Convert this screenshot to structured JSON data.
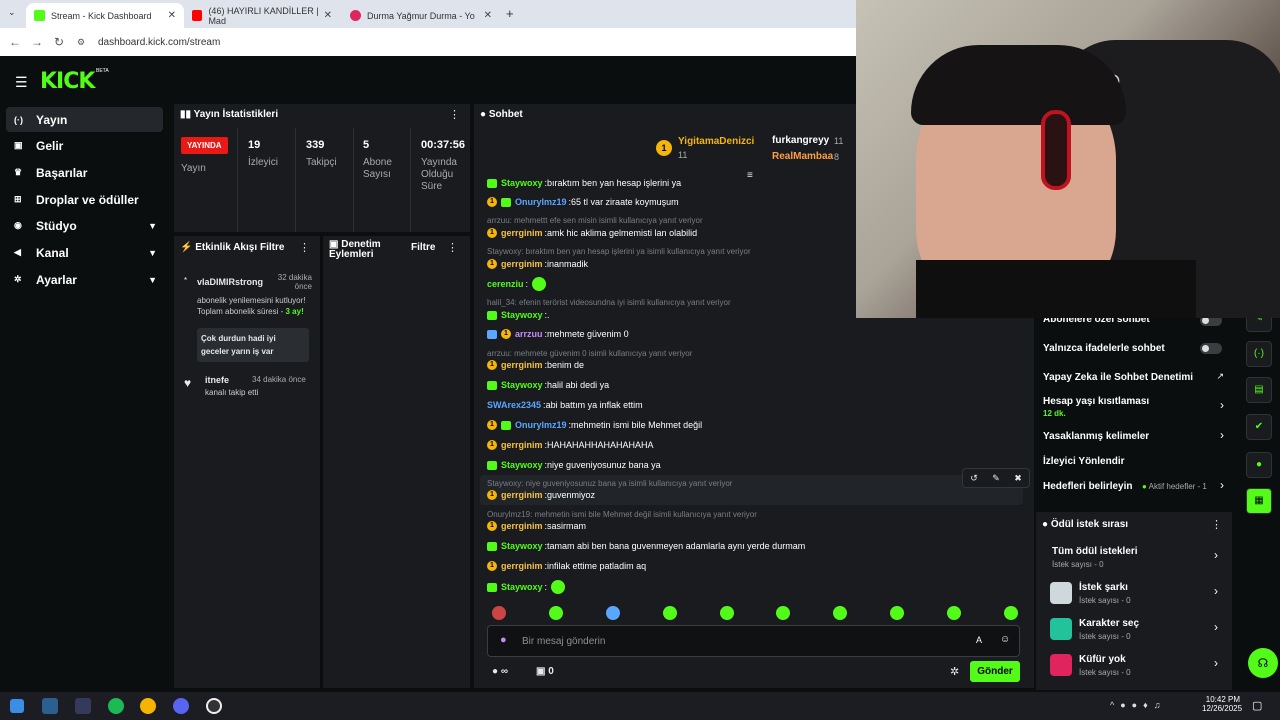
{
  "browser": {
    "tabs": [
      {
        "title": "Stream - Kick Dashboard"
      },
      {
        "title": "(46) HAYIRLI KANDİLLER | Mad"
      },
      {
        "title": "Durma Yağmur Durma - Yo"
      }
    ],
    "url": "dashboard.kick.com/stream"
  },
  "brand": {
    "logo": "KICK",
    "badge": "BETA"
  },
  "sidebar": {
    "items": [
      {
        "label": "Yayın",
        "icon": "broadcast-icon"
      },
      {
        "label": "Gelir",
        "icon": "revenue-icon"
      },
      {
        "label": "Başarılar",
        "icon": "trophy-icon"
      },
      {
        "label": "Droplar ve ödüller",
        "icon": "gift-icon"
      },
      {
        "label": "Stüdyo",
        "icon": "studio-icon"
      },
      {
        "label": "Kanal",
        "icon": "megaphone-icon"
      },
      {
        "label": "Ayarlar",
        "icon": "gear-icon"
      }
    ]
  },
  "stats": {
    "title": "Yayın İstatistikleri",
    "live": "YAYINDA",
    "live_label": "Yayın",
    "viewers": "19",
    "viewers_label": "İzleyici",
    "followers": "339",
    "followers_label": "Takipçi",
    "subs": "5",
    "subs_label": "Abone Sayısı",
    "uptime": "00:37:56",
    "uptime_label": "Yayında Olduğu Süre"
  },
  "activity": {
    "title": "Etkinlik Akışı",
    "filter": "Filtre",
    "e1_user": "vlaDIMIRstrong",
    "e1_time": "32 dakika önce",
    "e1_text": "abonelik yenilemesini kutluyor! Toplam abonelik süresi -",
    "e1_months": "3 ay!",
    "e1_msg": "Çok durdun hadi iyi geceler yarın iş var",
    "e2_user": "itnefe",
    "e2_time": "34 dakika önce",
    "e2_text": "kanalı takip etti"
  },
  "mod": {
    "title": "Denetim Eylemleri",
    "filter": "Filtre"
  },
  "chat": {
    "title": "Sohbet",
    "top1": "YigitamaDenizci",
    "top1_n": "11",
    "top2": "furkangreyy",
    "top2_n": "11",
    "top3": "RealMambaa",
    "top3_n": "8",
    "messages": [
      {
        "u": "Staywoxy",
        "t": "bıraktım ben yan hesap işlerini ya"
      },
      {
        "u": "Onurylmz19",
        "t": "65 tl var ziraate koymuşum"
      },
      {
        "r": "arrzuu: mehmettt efe sen misin isimli kullanıcıya yanıt veriyor"
      },
      {
        "u": "gerrginim",
        "t": "amk hic aklima gelmemisti lan olabilid"
      },
      {
        "r": "Staywoxy: bıraktım ben yan hesap işlerini ya isimli kullanıcıya yanıt veriyor"
      },
      {
        "u": "gerrginim",
        "t": "inanmadik"
      },
      {
        "u": "cerenziu",
        "t": ""
      },
      {
        "r": "halil_34: efenin terörist videosundna iyi isimli kullanıcıya yanıt veriyor"
      },
      {
        "u": "Staywoxy",
        "t": "."
      },
      {
        "u": "arrzuu",
        "t": "mehmete güvenim 0"
      },
      {
        "r": "arrzuu: mehmete güvenim 0 isimli kullanıcıya yanıt veriyor"
      },
      {
        "u": "gerrginim",
        "t": "benim de"
      },
      {
        "u": "Staywoxy",
        "t": "halil abi dedi ya"
      },
      {
        "u": "SWArex2345",
        "t": "abi battım ya inflak ettim"
      },
      {
        "u": "Onurylmz19",
        "t": "mehmetin ismi bile Mehmet değil"
      },
      {
        "u": "gerrginim",
        "t": "HAHAHAHHAHAHAHAHA"
      },
      {
        "u": "Staywoxy",
        "t": "niye guveniyosunuz bana ya"
      },
      {
        "r": "Staywoxy: niye guveniyosunuz bana ya isimli kullanıcıya yanıt veriyor"
      },
      {
        "u": "gerrginim",
        "t": "guvenmiyoz"
      },
      {
        "r": "Onurylmz19: mehmetin ismi bile Mehmet değil isimli kullanıcıya yanıt veriyor"
      },
      {
        "u": "gerrginim",
        "t": "sasirmam"
      },
      {
        "u": "Staywoxy",
        "t": "tamam abi ben bana guvenmeyen adamlarla aynı yerde durmam"
      },
      {
        "u": "gerrginim",
        "t": "infilak ettime patladim aq"
      },
      {
        "u": "Staywoxy",
        "t": ""
      }
    ],
    "placeholder": "Bir mesaj gönderin",
    "points": "0",
    "send": "Gönder"
  },
  "settings": {
    "items": [
      {
        "label": "Abonelere özel sohbet"
      },
      {
        "label": "Yalnızca ifadelerle sohbet"
      },
      {
        "label": "Yapay Zeka ile Sohbet Denetimi"
      },
      {
        "label": "Hesap yaşı kısıtlaması",
        "sub": "12 dk."
      },
      {
        "label": "Yasaklanmış kelimeler"
      },
      {
        "label": "İzleyici Yönlendir"
      },
      {
        "label": "Hedefleri belirleyin",
        "sub": "Aktif hedefler - 1"
      }
    ]
  },
  "rewards": {
    "title": "Ödül istek sırası",
    "items": [
      {
        "label": "Tüm ödül istekleri",
        "sub": "İstek sayısı - 0"
      },
      {
        "label": "İstek şarkı",
        "sub": "İstek sayısı - 0"
      },
      {
        "label": "Karakter seç",
        "sub": "İstek sayısı - 0"
      },
      {
        "label": "Küfür yok",
        "sub": "İstek sayısı - 0"
      }
    ]
  },
  "taskbar": {
    "time": "10:42 PM",
    "date": "12/26/2025"
  }
}
